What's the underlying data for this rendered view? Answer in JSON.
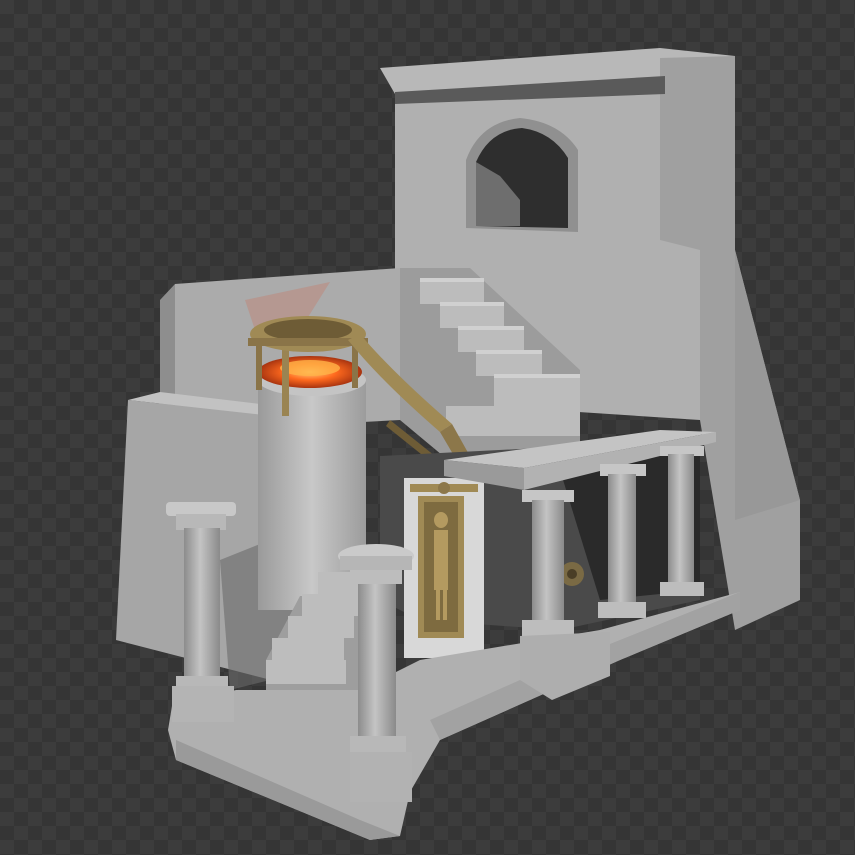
{
  "viewport": {
    "background": {
      "checker_light": "#3c3c3c",
      "checker_dark": "#353535"
    }
  },
  "scene": {
    "materials": {
      "stone_light": "#b4b4b4",
      "stone_mid": "#a4a4a4",
      "stone_dark": "#8e8e8e",
      "stone_shadow": "#5a5a5a",
      "opening_dark": "#2e2e2e",
      "bronze": "#a08a55",
      "bronze_dark": "#6e5c36",
      "fire_glow": "#ff6a1e",
      "fire_core": "#ffb347"
    },
    "objects": [
      "tower-block",
      "arched-window",
      "main-staircase",
      "lower-staircase",
      "left-wall",
      "cylindrical-furnace",
      "fire-brazier",
      "bronze-chute",
      "ornate-door-panel",
      "portico-roof",
      "column-left-front",
      "column-center-front",
      "portico-column-1",
      "portico-column-2",
      "portico-column-3",
      "base-platform",
      "gear-mechanism"
    ]
  }
}
